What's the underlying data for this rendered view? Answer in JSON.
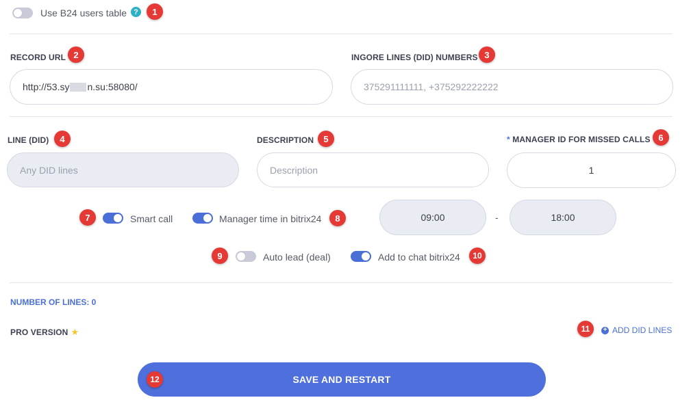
{
  "b24_toggle": {
    "label": "Use B24 users table",
    "help_glyph": "?"
  },
  "record_url": {
    "label": "RECORD URL",
    "value_prefix": "http://53.sy",
    "value_suffix": "n.su:58080/"
  },
  "ignore_lines": {
    "label": "INGORE LINES (DID) NUMBERS",
    "placeholder": "375291111111, +375292222222"
  },
  "line_did": {
    "label": "LINE (DID)",
    "placeholder": "Any DID lines"
  },
  "description": {
    "label": "DESCRIPTION",
    "placeholder": "Description"
  },
  "manager_id": {
    "required_mark": "*",
    "label": "MANAGER ID FOR MISSED CALLS",
    "value": "1"
  },
  "toggles": {
    "smart_call": "Smart call",
    "manager_time": "Manager time in bitrix24",
    "auto_lead": "Auto lead (deal)",
    "add_to_chat": "Add to chat bitrix24"
  },
  "time_range": {
    "start": "09:00",
    "separator": "-",
    "end": "18:00"
  },
  "number_of_lines": "NUMBER OF LINES: 0",
  "pro_version": {
    "label": "PRO VERSION",
    "star": "★"
  },
  "add_did_lines": {
    "plus": "+",
    "label": "ADD DID LINES"
  },
  "save_button": "SAVE AND RESTART",
  "markers": [
    "1",
    "2",
    "3",
    "4",
    "5",
    "6",
    "7",
    "8",
    "9",
    "10",
    "11",
    "12"
  ],
  "colors": {
    "accent": "#4a6fd6",
    "button": "#4f70dc",
    "marker": "#e53935",
    "help": "#2bb0c5"
  }
}
